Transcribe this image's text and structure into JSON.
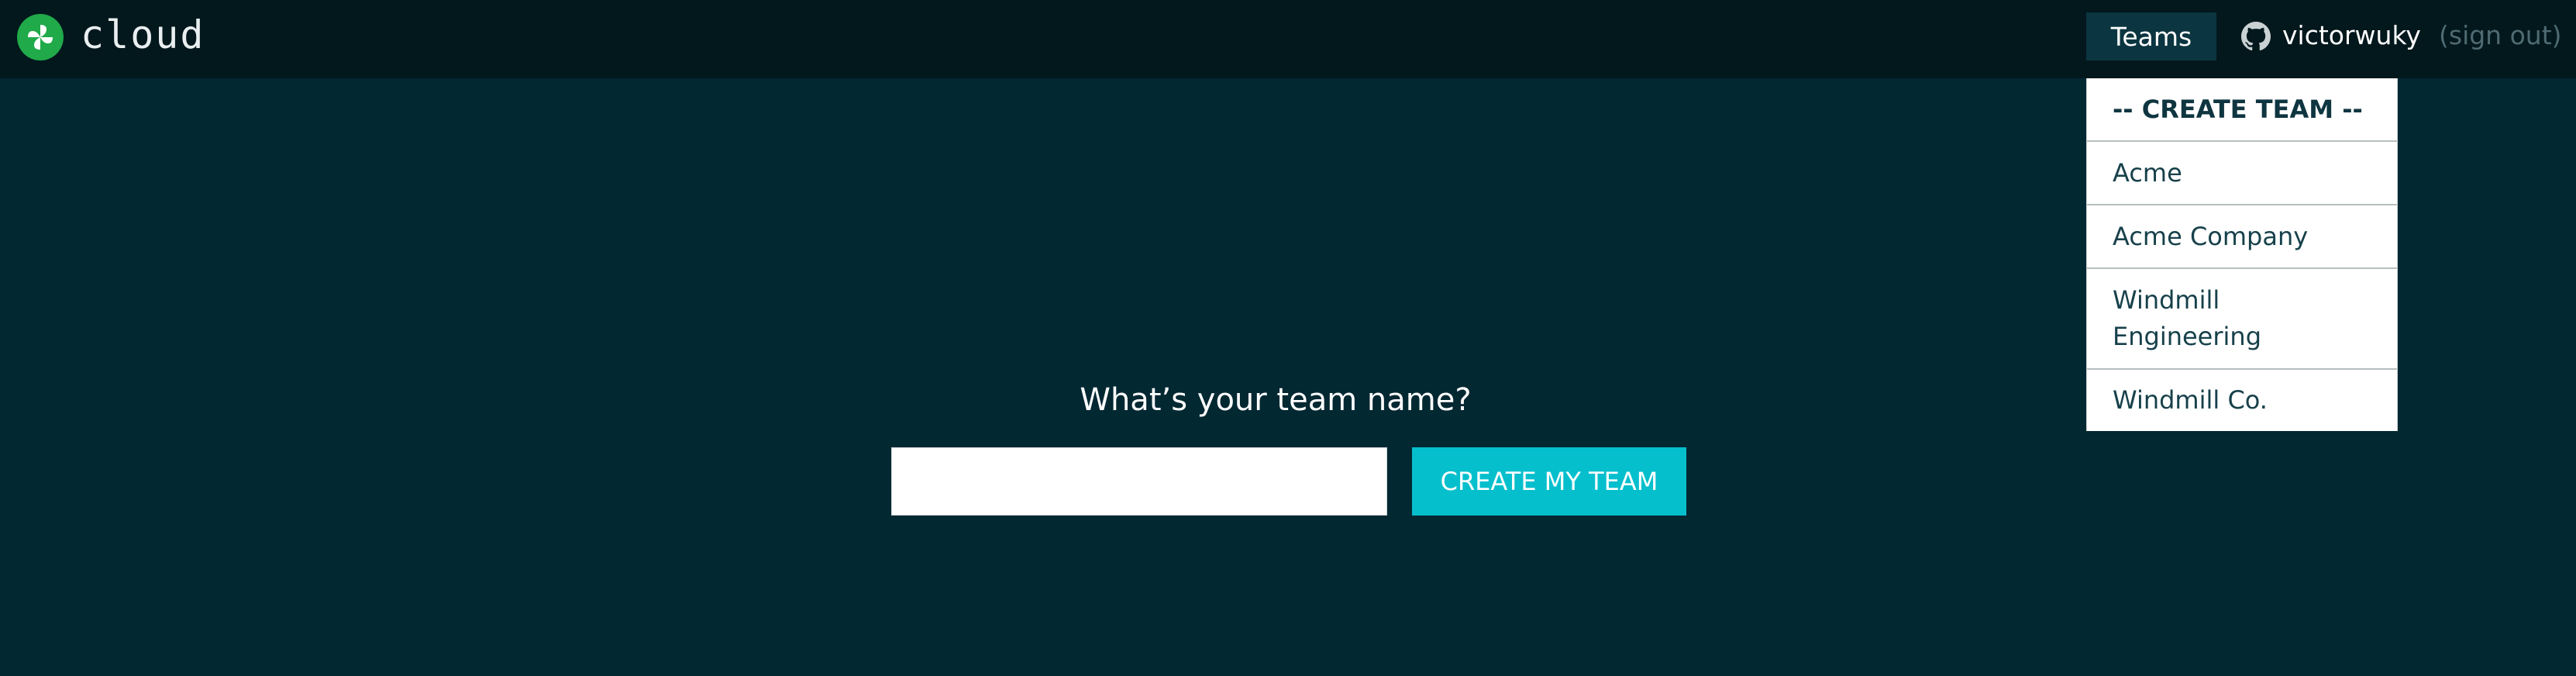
{
  "header": {
    "brand": "cloud",
    "logo_icon": "windmill-logo-icon",
    "teams_label": "Teams",
    "github_icon": "github-icon",
    "username": "victorwuky",
    "signout_label": "(sign out)"
  },
  "teams_dropdown": {
    "items": [
      {
        "label": "-- CREATE TEAM --"
      },
      {
        "label": "Acme"
      },
      {
        "label": "Acme Company"
      },
      {
        "label": "Windmill Engineering"
      },
      {
        "label": "Windmill Co."
      }
    ]
  },
  "main": {
    "prompt": "What’s your team name?",
    "team_name_value": "",
    "create_button_label": "CREATE MY TEAM"
  },
  "colors": {
    "background": "#022832",
    "topbar": "#02181d",
    "accent": "#06bfcd",
    "logo_green": "#20aa49"
  }
}
